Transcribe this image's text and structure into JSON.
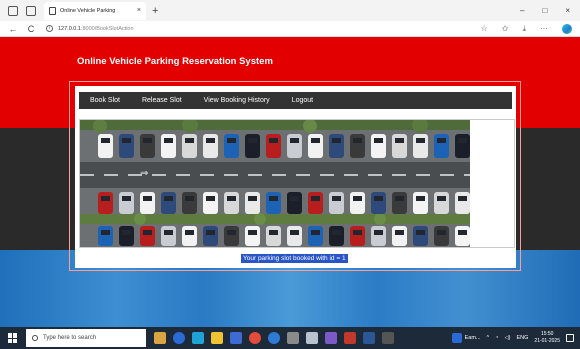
{
  "browser": {
    "tab_title": "Online Vehicle Parking",
    "tab_close": "×",
    "new_tab": "+",
    "back": "←",
    "refresh": "C",
    "url_host": "127.0.0.1",
    "url_path": ":8000/BookSlotAction",
    "win_min": "–",
    "win_max": "□",
    "win_close": "×",
    "more": "···"
  },
  "site": {
    "title": "Online Vehicle Parking Reservation System",
    "menu": [
      "Book Slot",
      "Release Slot",
      "View Booking History",
      "Logout"
    ],
    "message": "Your parking slot booked with id = 1"
  },
  "taskbar": {
    "search_placeholder": "Type here to search",
    "running_app": "Eam...",
    "lang": "ENG",
    "time": "15:50",
    "date": "21-01-2025"
  },
  "colors": {
    "header_red": "#e30000",
    "dark_band": "#2a2a2a",
    "blue_band": "#2b7cc6",
    "message_highlight": "#2a55c7"
  }
}
